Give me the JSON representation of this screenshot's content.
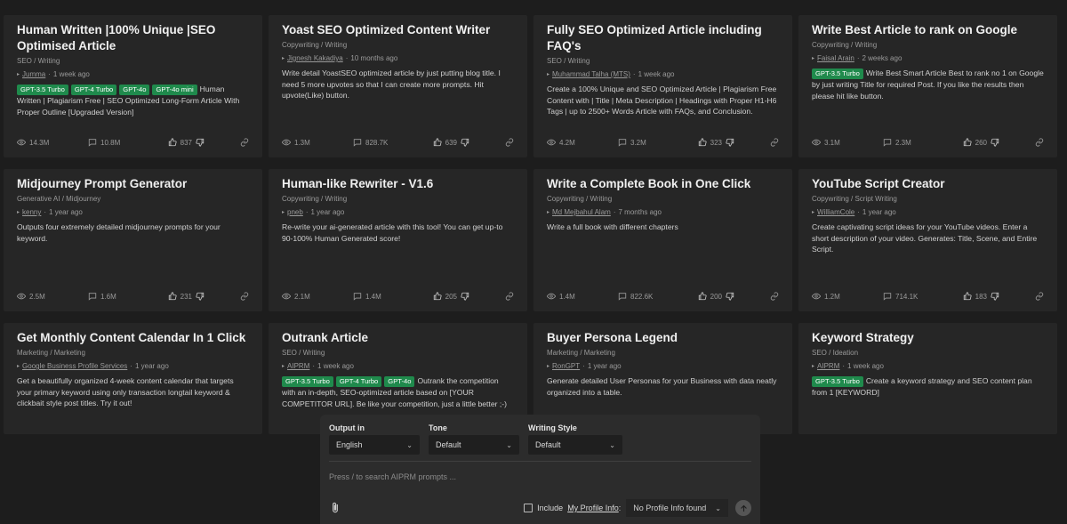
{
  "cards": [
    {
      "title": "Human Written |100% Unique |SEO Optimised Article",
      "category": "SEO / Writing",
      "author": "Jumma",
      "time": "1 week ago",
      "tags": [
        "GPT-3.5 Turbo",
        "GPT-4 Turbo",
        "GPT-4o",
        "GPT-4o mini"
      ],
      "desc": "Human Written | Plagiarism Free | SEO Optimized Long-Form Article With Proper Outline [Upgraded Version]",
      "views": "14.3M",
      "comments": "10.8M",
      "likes": "837"
    },
    {
      "title": "Yoast SEO Optimized Content Writer",
      "category": "Copywriting / Writing",
      "author": "Jignesh Kakadiya",
      "time": "10 months ago",
      "tags": [],
      "desc": "Write detail YoastSEO optimized article by just putting blog title. I need 5 more upvotes so that I can create more prompts. Hit upvote(Like) button.",
      "views": "1.3M",
      "comments": "828.7K",
      "likes": "639"
    },
    {
      "title": "Fully SEO Optimized Article including FAQ's",
      "category": "SEO / Writing",
      "author": "Muhammad Talha (MTS)",
      "time": "1 week ago",
      "tags": [],
      "desc": "Create a 100% Unique and SEO Optimized Article | Plagiarism Free Content with | Title | Meta Description | Headings with Proper H1-H6 Tags | up to 2500+ Words Article with FAQs, and Conclusion.",
      "views": "4.2M",
      "comments": "3.2M",
      "likes": "323"
    },
    {
      "title": "Write Best Article to rank on Google",
      "category": "Copywriting / Writing",
      "author": "Faisal Arain",
      "time": "2 weeks ago",
      "tags": [
        "GPT-3.5 Turbo"
      ],
      "desc": "Write Best Smart Article Best to rank no 1 on Google by just writing Title for required Post. If you like the results then please hit like button.",
      "views": "3.1M",
      "comments": "2.3M",
      "likes": "260"
    },
    {
      "title": "Midjourney Prompt Generator",
      "category": "Generative AI / Midjourney",
      "author": "kenny",
      "time": "1 year ago",
      "tags": [],
      "desc": "Outputs four extremely detailed midjourney prompts for your keyword.",
      "views": "2.5M",
      "comments": "1.6M",
      "likes": "231"
    },
    {
      "title": "Human-like Rewriter - V1.6",
      "category": "Copywriting / Writing",
      "author": "pneb",
      "time": "1 year ago",
      "tags": [],
      "desc": "Re-write your ai-generated article with this tool! You can get up-to 90-100% Human Generated score!",
      "views": "2.1M",
      "comments": "1.4M",
      "likes": "205"
    },
    {
      "title": "Write a Complete Book in One Click",
      "category": "Copywriting / Writing",
      "author": "Md Mejbahul Alam",
      "time": "7 months ago",
      "tags": [],
      "desc": "Write a full book with different chapters",
      "views": "1.4M",
      "comments": "822.6K",
      "likes": "200"
    },
    {
      "title": "YouTube Script Creator",
      "category": "Copywriting / Script Writing",
      "author": "WilliamCole",
      "time": "1 year ago",
      "tags": [],
      "desc": "Create captivating script ideas for your YouTube videos. Enter a short description of your video. Generates: Title, Scene, and Entire Script.",
      "views": "1.2M",
      "comments": "714.1K",
      "likes": "183"
    },
    {
      "title": "Get Monthly Content Calendar In 1 Click",
      "category": "Marketing / Marketing",
      "author": "Google Business Profile Services",
      "time": "1 year ago",
      "tags": [],
      "desc": "Get a beautifully organized 4-week content calendar that targets your primary keyword using only transaction longtail keyword & clickbait style post titles. Try it out!",
      "views": "",
      "comments": "",
      "likes": ""
    },
    {
      "title": "Outrank Article",
      "category": "SEO / Writing",
      "author": "AIPRM",
      "time": "1 week ago",
      "tags": [
        "GPT-3.5 Turbo",
        "GPT-4 Turbo",
        "GPT-4o"
      ],
      "desc": "Outrank the competition with an in-depth, SEO-optimized article based on [YOUR COMPETITOR URL]. Be like your competition, just a little better ;-)",
      "views": "",
      "comments": "",
      "likes": ""
    },
    {
      "title": "Buyer Persona Legend",
      "category": "Marketing / Marketing",
      "author": "RonGPT",
      "time": "1 year ago",
      "tags": [],
      "desc": "Generate detailed User Personas for your Business with data neatly organized into a table.",
      "views": "",
      "comments": "",
      "likes": ""
    },
    {
      "title": "Keyword Strategy",
      "category": "SEO / Ideation",
      "author": "AIPRM",
      "time": "1 week ago",
      "tags": [
        "GPT-3.5 Turbo"
      ],
      "desc": "Create a keyword strategy and SEO content plan from 1 [KEYWORD]",
      "views": "",
      "comments": "",
      "likes": ""
    }
  ],
  "panel": {
    "output_label": "Output in",
    "output_value": "English",
    "tone_label": "Tone",
    "tone_value": "Default",
    "style_label": "Writing Style",
    "style_value": "Default",
    "search_placeholder": "Press / to search AIPRM prompts ...",
    "include_label": "Include",
    "profile_link": "My Profile Info",
    "profile_colon": ":",
    "profile_value": "No Profile Info found"
  },
  "colors": {
    "tag_bg": "#1f8a4c",
    "card_bg": "#262626",
    "page_bg": "#1d1d1d"
  },
  "icons": [
    "eye-icon",
    "comment-icon",
    "thumbs-up-icon",
    "thumbs-down-icon",
    "link-icon",
    "paperclip-icon",
    "send-arrow-icon",
    "chevron-down-icon"
  ]
}
